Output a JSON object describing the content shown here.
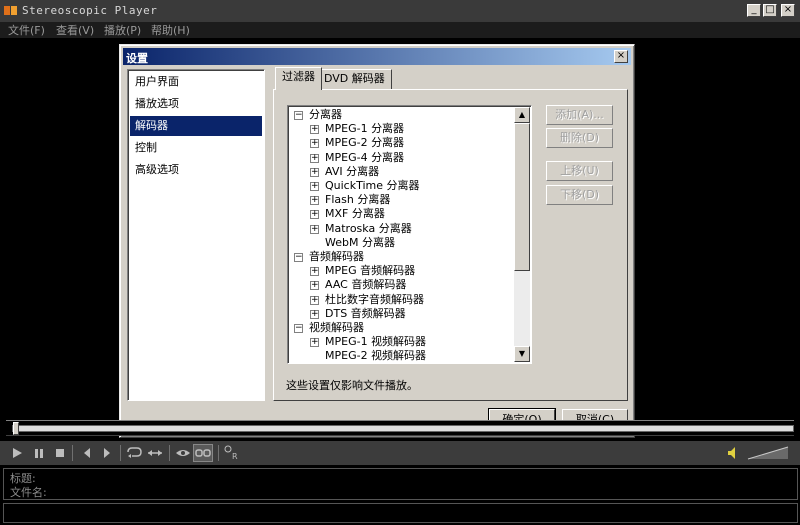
{
  "app": {
    "title": "Stereoscopic Player"
  },
  "menu": [
    "文件(F)",
    "查看(V)",
    "播放(P)",
    "帮助(H)"
  ],
  "dialog": {
    "title": "设置",
    "nav": [
      {
        "label": "用户界面",
        "selected": false
      },
      {
        "label": "播放选项",
        "selected": false
      },
      {
        "label": "解码器",
        "selected": true
      },
      {
        "label": "控制",
        "selected": false
      },
      {
        "label": "高级选项",
        "selected": false
      }
    ],
    "tabs": [
      {
        "label": "过滤器",
        "active": true
      },
      {
        "label": "DVD 解码器",
        "active": false
      }
    ],
    "tree": [
      {
        "label": "分离器",
        "level": 0,
        "expander": "minus"
      },
      {
        "label": "MPEG-1 分离器",
        "level": 1,
        "expander": "plus"
      },
      {
        "label": "MPEG-2 分离器",
        "level": 1,
        "expander": "plus"
      },
      {
        "label": "MPEG-4 分离器",
        "level": 1,
        "expander": "plus"
      },
      {
        "label": "AVI 分离器",
        "level": 1,
        "expander": "plus"
      },
      {
        "label": "QuickTime 分离器",
        "level": 1,
        "expander": "plus"
      },
      {
        "label": "Flash 分离器",
        "level": 1,
        "expander": "plus"
      },
      {
        "label": "MXF 分离器",
        "level": 1,
        "expander": "plus"
      },
      {
        "label": "Matroska 分离器",
        "level": 1,
        "expander": "plus"
      },
      {
        "label": "WebM 分离器",
        "level": 1,
        "expander": "none"
      },
      {
        "label": "音频解码器",
        "level": 0,
        "expander": "minus"
      },
      {
        "label": "MPEG 音频解码器",
        "level": 1,
        "expander": "plus"
      },
      {
        "label": "AAC 音频解码器",
        "level": 1,
        "expander": "plus"
      },
      {
        "label": "杜比数字音频解码器",
        "level": 1,
        "expander": "plus"
      },
      {
        "label": "DTS 音频解码器",
        "level": 1,
        "expander": "plus"
      },
      {
        "label": "视频解码器",
        "level": 0,
        "expander": "minus"
      },
      {
        "label": "MPEG-1 视频解码器",
        "level": 1,
        "expander": "plus"
      },
      {
        "label": "MPEG-2 视频解码器",
        "level": 1,
        "expander": "none"
      }
    ],
    "side_buttons": [
      "添加(A)...",
      "删除(D)",
      "上移(U)",
      "下移(D)"
    ],
    "note": "这些设置仅影响文件播放。",
    "ok": "确定(O)",
    "cancel": "取消(C)"
  },
  "info": {
    "title_label": "标题:",
    "filename_label": "文件名:"
  },
  "icons": [
    "app-icon",
    "minimize-icon",
    "maximize-icon",
    "close-icon",
    "play-icon",
    "pause-icon",
    "stop-icon",
    "previous-icon",
    "next-icon",
    "loop-icon",
    "ab-repeat-icon",
    "stereo-view-icon",
    "glasses-icon",
    "left-right-icon",
    "volume-icon"
  ],
  "colors": {
    "titlebar": "#0a246a",
    "selection": "#0a246a",
    "dialog": "#d4d0c8"
  }
}
